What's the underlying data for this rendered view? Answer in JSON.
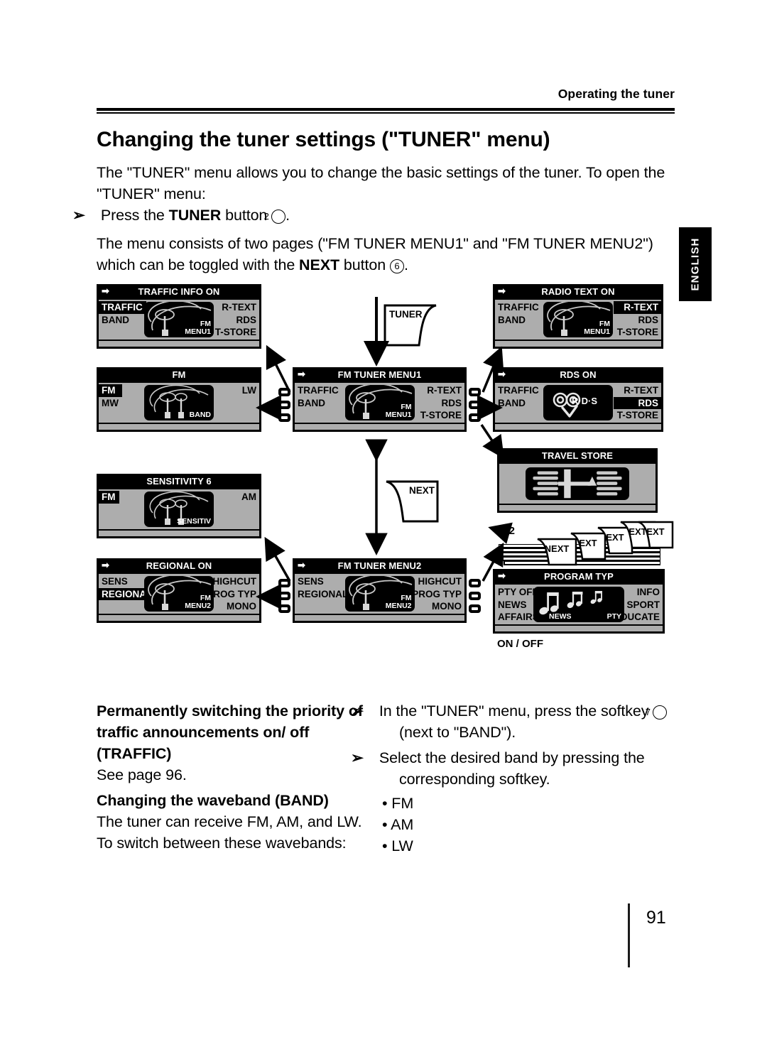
{
  "header": {
    "running_head": "Operating the tuner"
  },
  "title": "Changing the tuner settings (\"TUNER\" menu)",
  "intro": {
    "p1": "The \"TUNER\" menu allows you to change the basic settings of the tuner. To open the \"TUNER\" menu:",
    "p2_pre": "Press the ",
    "p2_bold": "TUNER",
    "p2_mid": " button ",
    "p2_num": "2",
    "p2_post": ".",
    "p3_pre": "The menu consists of two pages (\"FM TUNER MENU1\" and \"FM TUNER MENU2\") which can be toggled with the ",
    "p3_bold": "NEXT",
    "p3_mid": " button ",
    "p3_num": "6",
    "p3_post": "."
  },
  "side_tab": {
    "label": "ENGLISH"
  },
  "diagram": {
    "cards": [
      {
        "id": "tuner-card",
        "label": "TUNER"
      },
      {
        "id": "next-card",
        "label": "NEXT"
      }
    ],
    "stack_tabs": [
      {
        "label": "NEXT"
      },
      {
        "label": "EXT"
      },
      {
        "label": "EXT"
      },
      {
        "label": "EXT"
      },
      {
        "label": "EXT"
      }
    ],
    "labels": [
      {
        "id": "range-label",
        "text": "0..2"
      },
      {
        "id": "onoff-label",
        "text": "ON / OFF"
      }
    ],
    "panels": [
      {
        "id": "traffic-info-on",
        "title": "TRAFFIC INFO ON",
        "title_arrow": true,
        "left": [
          {
            "text": "TRAFFIC",
            "highlight": true
          },
          {
            "text": "BAND",
            "highlight": false
          }
        ],
        "right": [
          {
            "text": "R-TEXT",
            "highlight": false
          },
          {
            "text": "RDS",
            "highlight": false
          },
          {
            "text": "T-STORE",
            "highlight": false
          }
        ],
        "screen": {
          "icon": "antenna-one",
          "tag1": "FM",
          "tag2": "MENU1"
        }
      },
      {
        "id": "fm-band",
        "title": "FM",
        "title_arrow": false,
        "left": [
          {
            "text": "FM",
            "highlight": true
          },
          {
            "text": "MW",
            "highlight": false
          }
        ],
        "right": [
          {
            "text": "LW",
            "highlight": false
          }
        ],
        "screen": {
          "icon": "antenna-two",
          "tag1": "",
          "tag2": "BAND"
        }
      },
      {
        "id": "sensitivity",
        "title": "SENSITIVITY 6",
        "title_arrow": false,
        "left": [
          {
            "text": "FM",
            "highlight": true
          }
        ],
        "right": [
          {
            "text": "AM",
            "highlight": false
          }
        ],
        "screen": {
          "icon": "antenna-two",
          "tag1": "",
          "tag2": "SENSITIV"
        }
      },
      {
        "id": "regional-on",
        "title": "REGIONAL ON",
        "title_arrow": true,
        "left": [
          {
            "text": "SENS",
            "highlight": false
          },
          {
            "text": "REGIONAL",
            "highlight": true
          }
        ],
        "right": [
          {
            "text": "HIGHCUT",
            "highlight": false
          },
          {
            "text": "PROG TYP",
            "highlight": false
          },
          {
            "text": "MONO",
            "highlight": false
          }
        ],
        "screen": {
          "icon": "antenna-one",
          "tag1": "FM",
          "tag2": "MENU2"
        }
      },
      {
        "id": "fm-tuner-menu1",
        "title": "FM TUNER MENU1",
        "title_arrow": true,
        "left": [
          {
            "text": "TRAFFIC",
            "highlight": false
          },
          {
            "text": "BAND",
            "highlight": false
          }
        ],
        "right": [
          {
            "text": "R-TEXT",
            "highlight": false
          },
          {
            "text": "RDS",
            "highlight": false
          },
          {
            "text": "T-STORE",
            "highlight": false
          }
        ],
        "screen": {
          "icon": "antenna-one",
          "tag1": "FM",
          "tag2": "MENU1"
        }
      },
      {
        "id": "fm-tuner-menu2",
        "title": "FM TUNER MENU2",
        "title_arrow": true,
        "left": [
          {
            "text": "SENS",
            "highlight": false
          },
          {
            "text": "REGIONAL",
            "highlight": false
          }
        ],
        "right": [
          {
            "text": "HIGHCUT",
            "highlight": false
          },
          {
            "text": "PROG TYP",
            "highlight": false
          },
          {
            "text": "MONO",
            "highlight": false
          }
        ],
        "screen": {
          "icon": "antenna-one",
          "tag1": "FM",
          "tag2": "MENU2"
        }
      },
      {
        "id": "radio-text-on",
        "title": "RADIO TEXT ON",
        "title_arrow": true,
        "left": [
          {
            "text": "TRAFFIC",
            "highlight": false
          },
          {
            "text": "BAND",
            "highlight": false
          }
        ],
        "right": [
          {
            "text": "R-TEXT",
            "highlight": true
          },
          {
            "text": "RDS",
            "highlight": false
          },
          {
            "text": "T-STORE",
            "highlight": false
          }
        ],
        "screen": {
          "icon": "antenna-one",
          "tag1": "FM",
          "tag2": "MENU1"
        }
      },
      {
        "id": "rds-on",
        "title": "RDS ON",
        "title_arrow": true,
        "left": [
          {
            "text": "TRAFFIC",
            "highlight": false
          },
          {
            "text": "BAND",
            "highlight": false
          }
        ],
        "right": [
          {
            "text": "R-TEXT",
            "highlight": false
          },
          {
            "text": "RDS",
            "highlight": true
          },
          {
            "text": "T-STORE",
            "highlight": false
          }
        ],
        "screen": {
          "icon": "rds-logo",
          "logo_text": "R·D·S",
          "tag1": "",
          "tag2": ""
        }
      },
      {
        "id": "travel-store",
        "title": "TRAVEL STORE",
        "title_arrow": false,
        "left": [],
        "right": [],
        "screen": {
          "icon": "travel-store",
          "tag1": "",
          "tag2": ""
        }
      },
      {
        "id": "program-typ",
        "title": "PROGRAM TYP",
        "title_arrow": true,
        "left": [
          {
            "text": "PTY OFF",
            "highlight": false
          },
          {
            "text": "NEWS",
            "highlight": false
          },
          {
            "text": "AFFAIRS",
            "highlight": false
          }
        ],
        "right": [
          {
            "text": "INFO",
            "highlight": false
          },
          {
            "text": "SPORT",
            "highlight": false
          },
          {
            "text": "EDUCATE",
            "highlight": false
          }
        ],
        "screen": {
          "icon": "music-notes",
          "tag1": "NEWS",
          "tag2": "PTY"
        }
      }
    ]
  },
  "bottom_left": {
    "heading1": "Permanently switching the priority of traffic announcements on/ off (TRAFFIC)",
    "body1": "See page 96.",
    "heading2": "Changing the waveband (BAND)",
    "body2": "The tuner can receive FM, AM, and LW. To switch between these wavebands:"
  },
  "bottom_right": {
    "step1_pre": "In the \"TUNER\" menu, press the softkey ",
    "step1_num": "7",
    "step1_post": " (next to \"BAND\").",
    "step2": "Select the desired band by pressing the corresponding softkey.",
    "bullets": [
      "FM",
      "AM",
      "LW"
    ]
  },
  "footer": {
    "page_number": "91"
  }
}
